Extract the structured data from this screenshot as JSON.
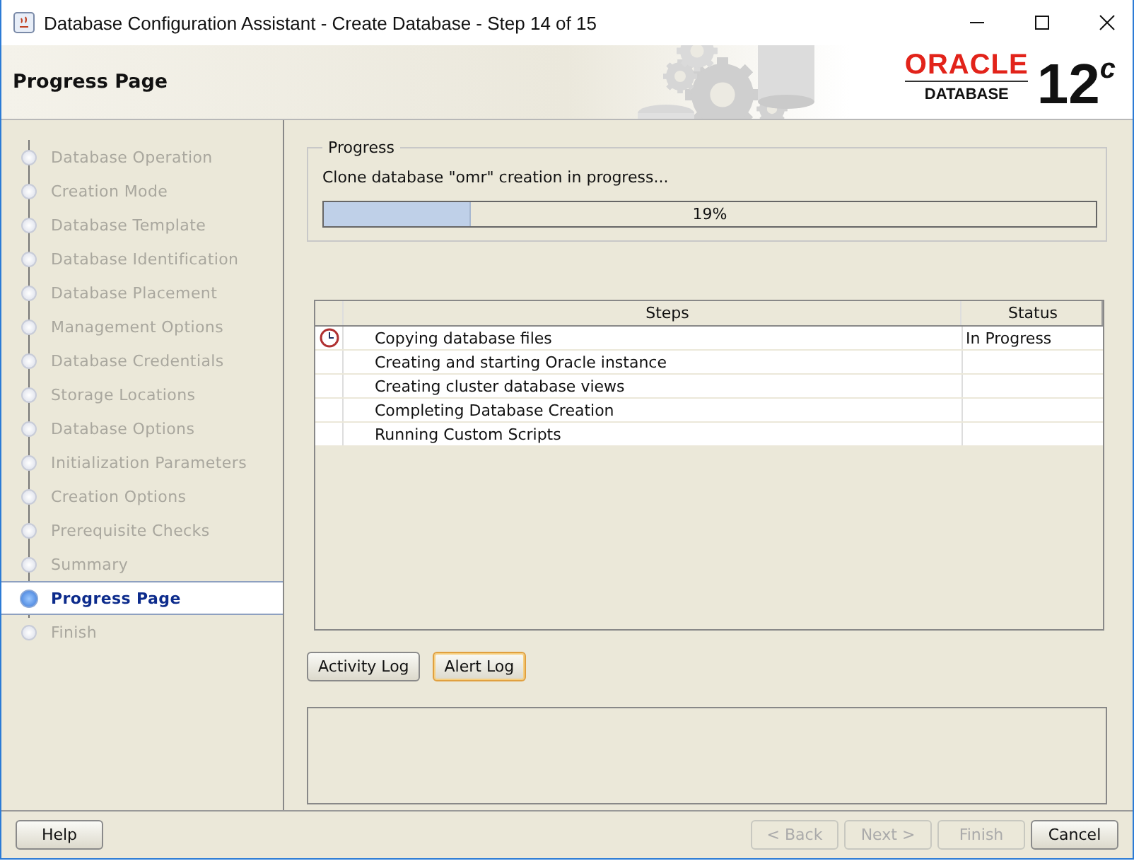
{
  "window": {
    "title": "Database Configuration Assistant - Create Database - Step 14 of 15"
  },
  "header": {
    "title": "Progress Page",
    "brand": "ORACLE",
    "product": "DATABASE",
    "version": "12",
    "version_sup": "c"
  },
  "steps": [
    {
      "label": "Database Operation",
      "selected": false
    },
    {
      "label": "Creation Mode",
      "selected": false
    },
    {
      "label": "Database Template",
      "selected": false
    },
    {
      "label": "Database Identification",
      "selected": false
    },
    {
      "label": "Database Placement",
      "selected": false
    },
    {
      "label": "Management Options",
      "selected": false
    },
    {
      "label": "Database Credentials",
      "selected": false
    },
    {
      "label": "Storage Locations",
      "selected": false
    },
    {
      "label": "Database Options",
      "selected": false
    },
    {
      "label": "Initialization Parameters",
      "selected": false
    },
    {
      "label": "Creation Options",
      "selected": false
    },
    {
      "label": "Prerequisite Checks",
      "selected": false
    },
    {
      "label": "Summary",
      "selected": false
    },
    {
      "label": "Progress Page",
      "selected": true
    },
    {
      "label": "Finish",
      "selected": false
    }
  ],
  "progress": {
    "legend": "Progress",
    "message": "Clone database \"omr\" creation in progress...",
    "level": 0.19,
    "reading": "19%"
  },
  "table": {
    "columns": [
      "Steps",
      "Status"
    ],
    "rows": [
      {
        "kind": "clock",
        "step": "Copying database files",
        "status": "In Progress"
      },
      {
        "step": "Creating and starting Oracle instance"
      },
      {
        "step": "Creating cluster database views"
      },
      {
        "step": "Completing Database Creation"
      },
      {
        "step": "Running Custom Scripts"
      }
    ]
  },
  "log_buttons": [
    {
      "label": "Activity Log",
      "focused": false
    },
    {
      "label": "Alert Log",
      "focused": true
    }
  ],
  "footer": {
    "help": "Help",
    "buttons": [
      {
        "label": "< Back",
        "disabled": true
      },
      {
        "label": "Next >",
        "disabled": true
      },
      {
        "label": "Finish",
        "disabled": true
      },
      {
        "label": "Cancel",
        "disabled": false
      }
    ]
  }
}
